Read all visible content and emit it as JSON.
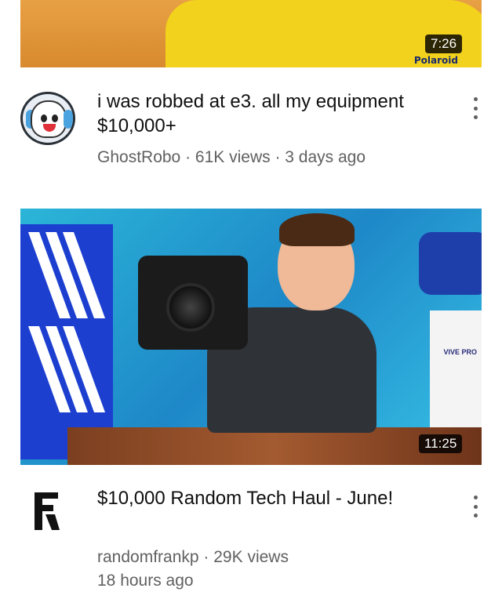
{
  "videos": [
    {
      "title": "i was robbed at e3. all my equipment $10,000+",
      "channel": "GhostRobo",
      "views": "61K views",
      "age": "3 days ago",
      "duration": "7:26",
      "thumbnail_mark": "Polaroid"
    },
    {
      "title": "$10,000 Random Tech Haul - June!",
      "channel": "randomfrankp",
      "views": "29K views",
      "age": "18 hours ago",
      "duration": "11:25",
      "thumbnail_mark": "VIVE PRO"
    }
  ],
  "separator": " · ",
  "icons": {
    "channel1_avatar": "ghost-avatar-icon",
    "channel2_avatar": "rf-logo-icon",
    "menu": "more-vert-icon"
  },
  "colors": {
    "title": "#0f0f0f",
    "meta": "#606060",
    "duration_bg": "#000000"
  }
}
